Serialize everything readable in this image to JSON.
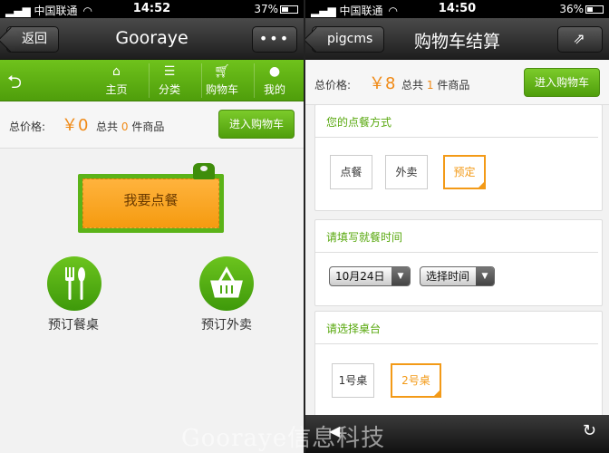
{
  "left": {
    "status": {
      "carrier": "中国联通",
      "time": "14:52",
      "battery": "37%",
      "battery_level": 0.37
    },
    "nav": {
      "back_label": "返回",
      "title": "Gooraye",
      "more_label": "•••"
    },
    "menu": {
      "items": [
        {
          "label": "主页",
          "icon": "home-icon"
        },
        {
          "label": "分类",
          "icon": "list-icon"
        },
        {
          "label": "购物车",
          "icon": "cart-icon"
        },
        {
          "label": "我的",
          "icon": "user-icon"
        }
      ]
    },
    "summary": {
      "label": "总价格:",
      "price": "￥0",
      "count_prefix": "总共",
      "count": "0",
      "count_suffix": "件商品",
      "cart_button": "进入购物车"
    },
    "order_button": "我要点餐",
    "options": [
      {
        "label": "预订餐桌",
        "icon": "cutlery-icon"
      },
      {
        "label": "预订外卖",
        "icon": "basket-icon"
      }
    ]
  },
  "right": {
    "status": {
      "carrier": "中国联通",
      "time": "14:50",
      "battery": "36%",
      "battery_level": 0.36
    },
    "nav": {
      "back_label": "pigcms",
      "title": "购物车结算"
    },
    "summary": {
      "label": "总价格:",
      "price": "￥8",
      "count_prefix": "总共",
      "count": "1",
      "count_suffix": "件商品",
      "cart_button": "进入购物车"
    },
    "dining_method": {
      "title": "您的点餐方式",
      "options": [
        "点餐",
        "外卖",
        "预定"
      ],
      "selected": "预定"
    },
    "dining_time": {
      "title": "请填写就餐时间",
      "date": "10月24日",
      "time_placeholder": "选择时间"
    },
    "table_select": {
      "title": "请选择桌台",
      "options": [
        "1号桌",
        "2号桌"
      ],
      "selected": "2号桌"
    }
  },
  "watermark": "Gooraye信息科技",
  "colors": {
    "green": "#5bb318",
    "orange": "#f39a17"
  }
}
